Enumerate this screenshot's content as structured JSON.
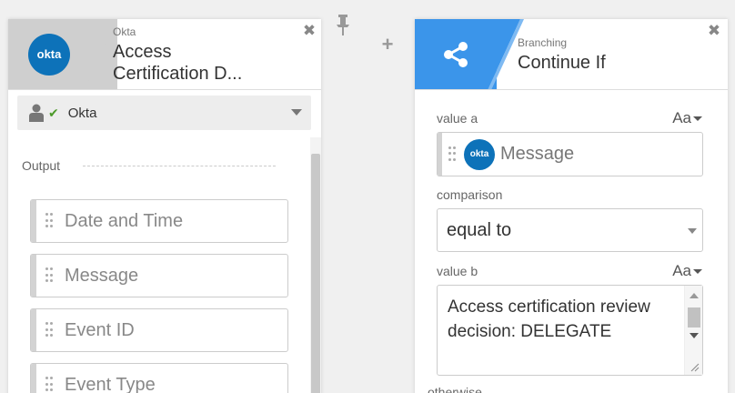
{
  "okta_card": {
    "app_name": "Okta",
    "title_line1": "Access",
    "title_line2": "Certification D...",
    "logo_text": "okta",
    "close_symbol": "✖",
    "account": {
      "label": "Okta",
      "check_symbol": "✔"
    },
    "output": {
      "label": "Output",
      "fields": [
        {
          "label": "Date and Time"
        },
        {
          "label": "Message"
        },
        {
          "label": "Event ID"
        },
        {
          "label": "Event Type"
        }
      ]
    }
  },
  "connector": {
    "plus_symbol": "+"
  },
  "branch_card": {
    "app_name": "Branching",
    "title": "Continue If",
    "close_symbol": "✖",
    "icon": "share-icon",
    "brand_color": "#3b95ea",
    "value_a": {
      "label": "value a",
      "format_toggle": "Aa",
      "token_logo": "okta",
      "token_label": "Message"
    },
    "comparison": {
      "label": "comparison",
      "selected": "equal to"
    },
    "value_b": {
      "label": "value b",
      "format_toggle": "Aa",
      "text": "Access certification review decision: DELEGATE"
    },
    "otherwise_label": "otherwise"
  }
}
